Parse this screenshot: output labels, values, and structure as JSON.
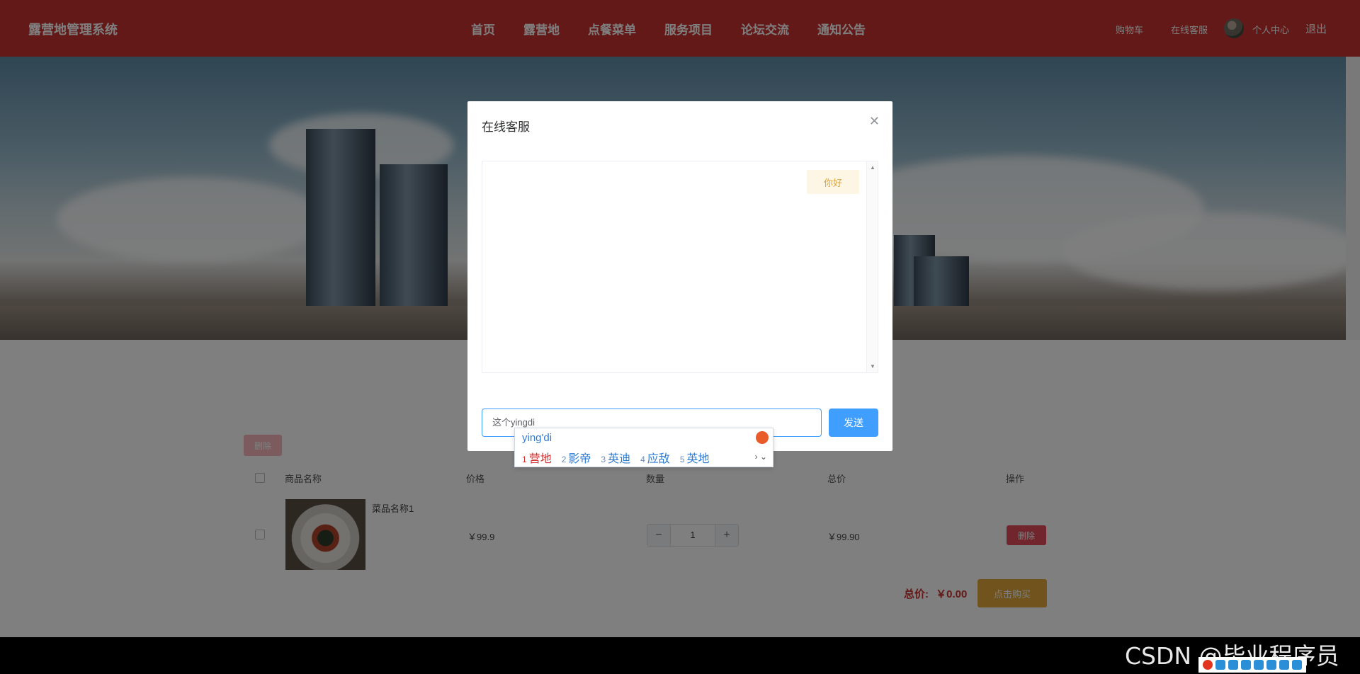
{
  "header": {
    "brand": "露营地管理系统",
    "nav": [
      "首页",
      "露营地",
      "点餐菜单",
      "服务项目",
      "论坛交流",
      "通知公告"
    ],
    "right": {
      "cart": "购物车",
      "service": "在线客服",
      "profile": "个人中心",
      "logout": "退出"
    }
  },
  "cart": {
    "delete_top": "删除",
    "columns": {
      "name": "商品名称",
      "price": "价格",
      "qty": "数量",
      "total": "总价",
      "ops": "操作"
    },
    "row": {
      "name": "菜品名称1",
      "price": "￥99.9",
      "qty": "1",
      "total": "￥99.90",
      "delete": "删除"
    },
    "summary_label": "总价:",
    "summary_value": "￥0.00",
    "buy": "点击购买"
  },
  "dialog": {
    "title": "在线客服",
    "message": "你好",
    "input_value": "这个yingdi",
    "send": "发送"
  },
  "ime": {
    "composition": "ying'di",
    "candidates": [
      {
        "n": "1",
        "text": "营地"
      },
      {
        "n": "2",
        "text": "影帝"
      },
      {
        "n": "3",
        "text": "英迪"
      },
      {
        "n": "4",
        "text": "应敌"
      },
      {
        "n": "5",
        "text": "英地"
      }
    ],
    "arrows": "› ⌄"
  },
  "watermark": "CSDN @毕业程序员"
}
